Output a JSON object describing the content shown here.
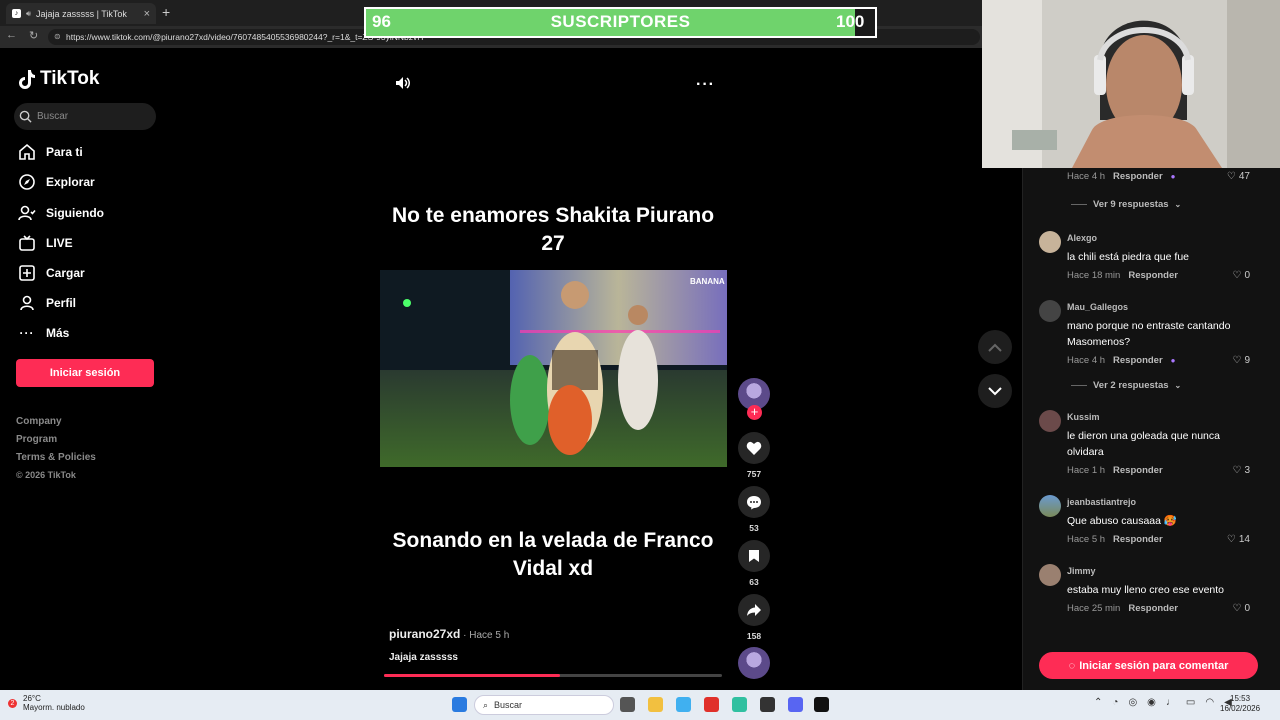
{
  "browser": {
    "tab_title": "Jajaja zasssss | TikTok",
    "tab_close": "×",
    "new_tab": "+",
    "url": "https://www.tiktok.com/@piurano27xd/video/7607485405536980244?_r=1&_t=ZS-93yiNNbzvH"
  },
  "subscriber_bar": {
    "current": "96",
    "label": "SUSCRIPTORES",
    "goal": "100",
    "progress_fraction": 0.96,
    "fill_color": "#6fd36c"
  },
  "sidebar": {
    "logo": "TikTok",
    "search_placeholder": "Buscar",
    "nav": [
      {
        "label": "Para ti",
        "icon": "home-icon"
      },
      {
        "label": "Explorar",
        "icon": "compass-icon"
      },
      {
        "label": "Siguiendo",
        "icon": "following-icon"
      },
      {
        "label": "LIVE",
        "icon": "live-icon"
      },
      {
        "label": "Cargar",
        "icon": "upload-icon"
      },
      {
        "label": "Perfil",
        "icon": "profile-icon"
      },
      {
        "label": "Más",
        "icon": "more-icon"
      }
    ],
    "login_button": "Iniciar sesión",
    "footer_links": [
      "Company",
      "Program",
      "Terms & Policies"
    ],
    "copyright": "© 2026 TikTok"
  },
  "video": {
    "top_text": "No te enamores Shakita Piurano 27",
    "bottom_text": "Sonando en la velada de Franco Vidal xd",
    "author": "piurano27xd",
    "time": " · Hace 5 h",
    "caption": "Jajaja zasssss",
    "progress_fraction": 0.52
  },
  "actions": {
    "likes": "757",
    "comments": "53",
    "saves": "63",
    "shares": "158",
    "follow_label": "+"
  },
  "comments": {
    "top_meta": {
      "time": "Hace 4 h",
      "reply": "Responder",
      "likes": "47"
    },
    "top_replies": "Ver 9 respuestas",
    "items": [
      {
        "user": "Alexgo",
        "text": "la chili está piedra que fue",
        "time": "Hace 18 min",
        "reply": "Responder",
        "likes": "0"
      },
      {
        "user": "Mau_Gallegos",
        "text": "mano porque no entraste cantando Masomenos?",
        "time": "Hace 4 h",
        "reply": "Responder",
        "likes": "9"
      },
      {
        "user": "Kussim",
        "text": "le dieron una goleada que nunca olvidara",
        "time": "Hace 1 h",
        "reply": "Responder",
        "likes": "3"
      },
      {
        "user": "jeanbastiantrejo",
        "text": "Que abuso causaaa 🥵",
        "time": "Hace 5 h",
        "reply": "Responder",
        "likes": "14"
      },
      {
        "user": "Jimmy",
        "text": "estaba muy lleno creo ese evento",
        "time": "Hace 25 min",
        "reply": "Responder",
        "likes": "0"
      }
    ],
    "mau_replies": "Ver 2 respuestas",
    "login_button": "Iniciar sesión para comentar"
  },
  "taskbar": {
    "weather_temp": "26°C",
    "weather_desc": "Mayorm. nublado",
    "weather_badge": "2",
    "search_label": "Buscar",
    "time": "15:53",
    "date": "16/02/2026"
  },
  "colors": {
    "accent": "#fe2c55",
    "background": "#000000",
    "panel": "#121212"
  }
}
